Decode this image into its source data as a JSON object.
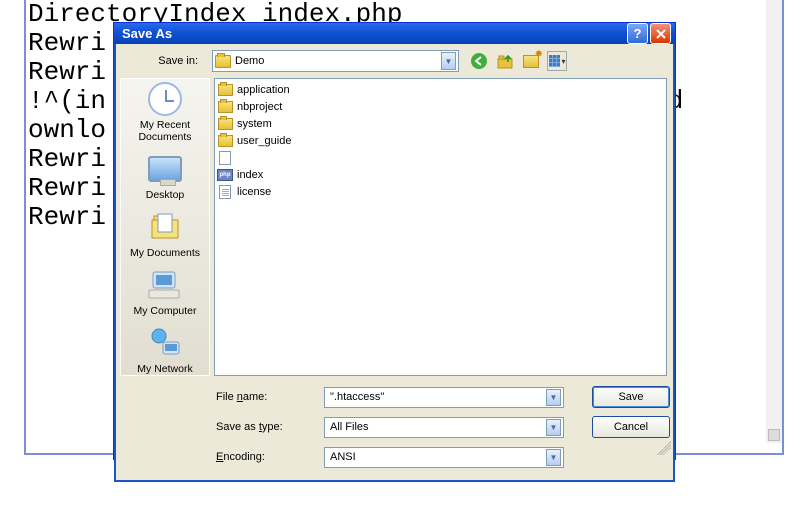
{
  "background_lines": [
    "DirectoryIndex index.php",
    "Rewri",
    "Rewri",
    "!^(in                                css|d",
    "ownlo",
    "Rewri",
    "Rewri",
    "Rewri                                QSA]"
  ],
  "dialog": {
    "title": "Save As",
    "save_in_label": "Save in:",
    "save_in_value": "Demo",
    "places": {
      "recent": "My Recent Documents",
      "desktop": "Desktop",
      "mydocs": "My Documents",
      "mycomp": "My Computer",
      "mynet": "My Network"
    },
    "files": [
      {
        "type": "folder",
        "name": "application"
      },
      {
        "type": "folder",
        "name": "nbproject"
      },
      {
        "type": "folder",
        "name": "system"
      },
      {
        "type": "folder",
        "name": "user_guide"
      },
      {
        "type": "file",
        "name": ""
      },
      {
        "type": "php",
        "name": "index"
      },
      {
        "type": "txt",
        "name": "license"
      }
    ],
    "filename_label": "File name:",
    "filename_value": "\".htaccess\"",
    "saveastype_label": "Save as type:",
    "saveastype_value": "All Files",
    "encoding_label": "Encoding:",
    "encoding_value": "ANSI",
    "save_btn": "Save",
    "cancel_btn": "Cancel"
  }
}
